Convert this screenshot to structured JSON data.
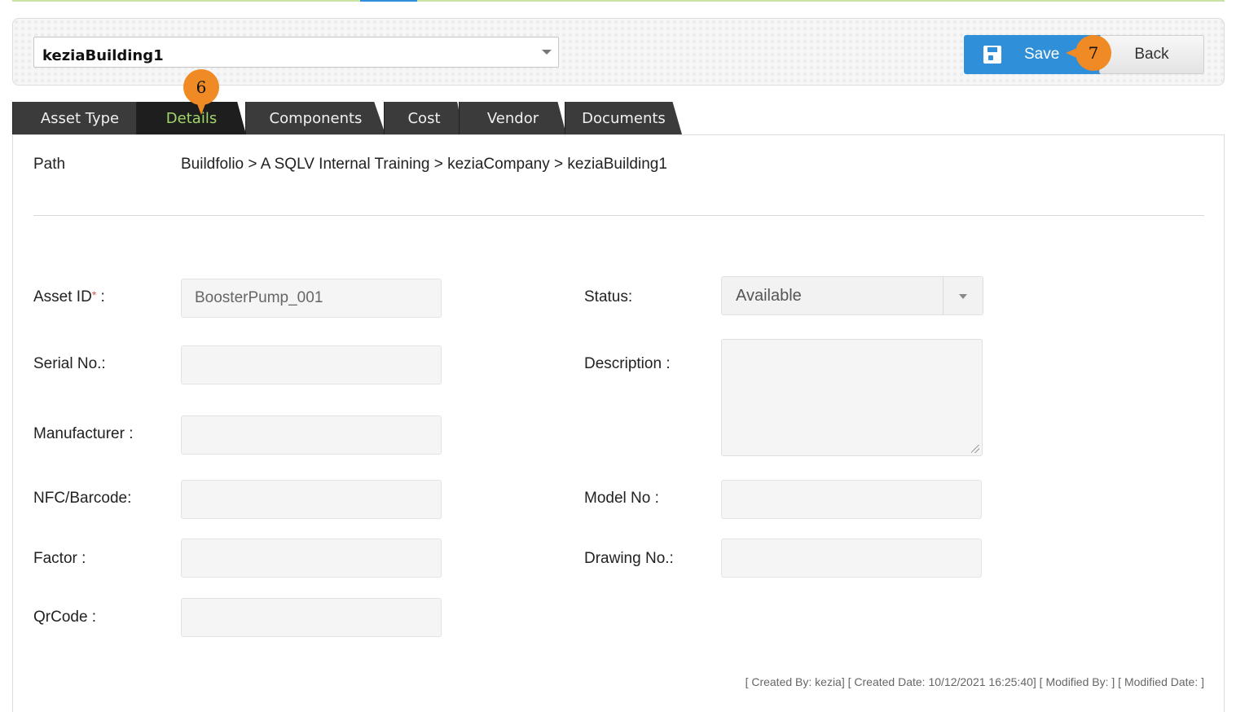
{
  "header": {
    "building_value": "keziaBuilding1",
    "save_label": "Save",
    "back_label": "Back",
    "step_markers": [
      "6",
      "7"
    ]
  },
  "tabs": [
    {
      "label": "Asset Type",
      "active": false
    },
    {
      "label": "Details",
      "active": true
    },
    {
      "label": "Components",
      "active": false
    },
    {
      "label": "Cost",
      "active": false
    },
    {
      "label": "Vendor",
      "active": false
    },
    {
      "label": "Documents",
      "active": false
    }
  ],
  "path": {
    "label": "Path",
    "value": "Buildfolio > A SQLV Internal Training > keziaCompany > keziaBuilding1"
  },
  "form": {
    "asset_id_label": "Asset ID",
    "asset_id_required": "*",
    "asset_id_colon": " :",
    "asset_id_value": "BoosterPump_001",
    "serial_label": "Serial No.:",
    "serial_value": "",
    "manufacturer_label": "Manufacturer :",
    "manufacturer_value": "",
    "nfc_label": "NFC/Barcode:",
    "nfc_value": "",
    "factor_label": "Factor :",
    "factor_value": "",
    "qrcode_label": "QrCode :",
    "qrcode_value": "",
    "status_label": "Status:",
    "status_value": "Available",
    "description_label": "Description :",
    "description_value": "",
    "model_label": "Model No :",
    "model_value": "",
    "drawing_label": "Drawing No.:",
    "drawing_value": ""
  },
  "audit": "[ Created By: kezia] [ Created Date: 10/12/2021 16:25:40] [ Modified By: ] [ Modified Date: ]",
  "colors": {
    "primary": "#2f8fd8",
    "marker": "#f08a24",
    "active_tab_text": "#9fd66b",
    "tab_bg": "#3b3b3b"
  },
  "icons": {
    "save": "floppy-disk-icon",
    "building_dropdown": "chevron-down-icon",
    "status_dropdown": "chevron-down-icon"
  }
}
